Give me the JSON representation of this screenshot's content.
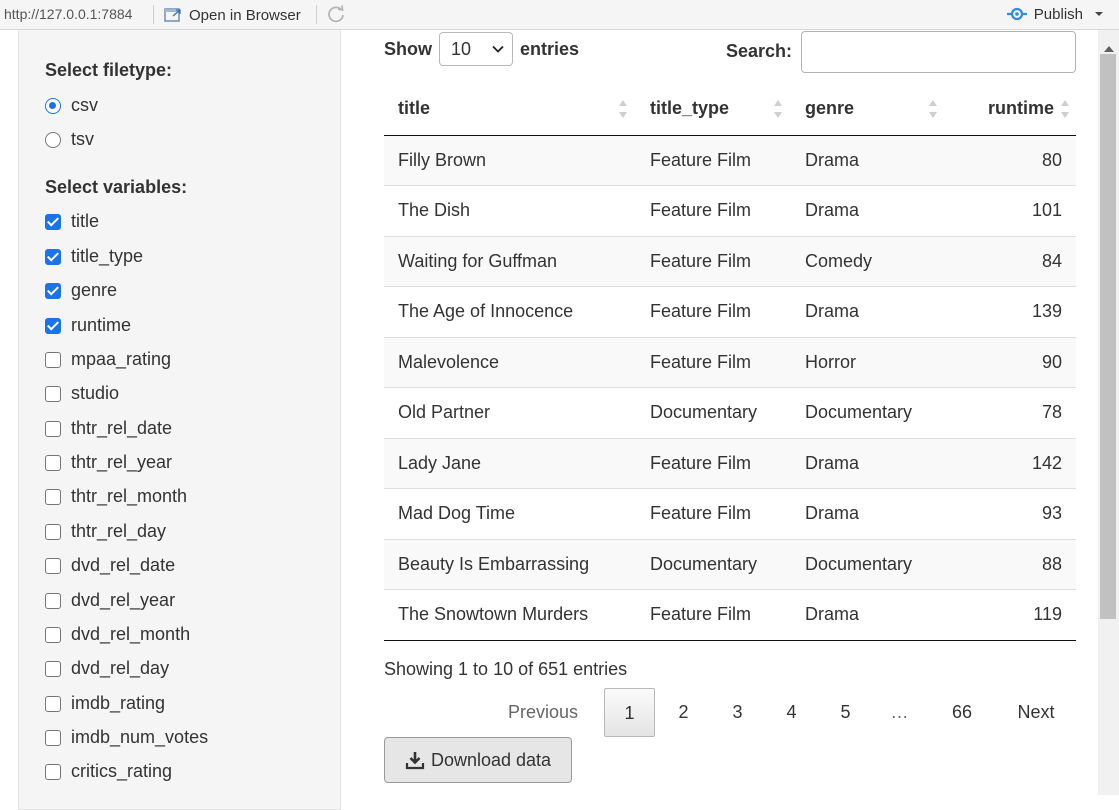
{
  "topbar": {
    "url": "http://127.0.0.1:7884",
    "open_in_browser": "Open in Browser",
    "publish": "Publish",
    "icons": [
      "open-browser-icon",
      "refresh-icon",
      "publish-icon",
      "caret-down-icon"
    ]
  },
  "sidebar": {
    "filetype_label": "Select filetype:",
    "filetypes": [
      {
        "label": "csv",
        "selected": true
      },
      {
        "label": "tsv",
        "selected": false
      }
    ],
    "variables_label": "Select variables:",
    "variables": [
      {
        "label": "title",
        "checked": true
      },
      {
        "label": "title_type",
        "checked": true
      },
      {
        "label": "genre",
        "checked": true
      },
      {
        "label": "runtime",
        "checked": true
      },
      {
        "label": "mpaa_rating",
        "checked": false
      },
      {
        "label": "studio",
        "checked": false
      },
      {
        "label": "thtr_rel_date",
        "checked": false
      },
      {
        "label": "thtr_rel_year",
        "checked": false
      },
      {
        "label": "thtr_rel_month",
        "checked": false
      },
      {
        "label": "thtr_rel_day",
        "checked": false
      },
      {
        "label": "dvd_rel_date",
        "checked": false
      },
      {
        "label": "dvd_rel_year",
        "checked": false
      },
      {
        "label": "dvd_rel_month",
        "checked": false
      },
      {
        "label": "dvd_rel_day",
        "checked": false
      },
      {
        "label": "imdb_rating",
        "checked": false
      },
      {
        "label": "imdb_num_votes",
        "checked": false
      },
      {
        "label": "critics_rating",
        "checked": false
      }
    ]
  },
  "table_controls": {
    "show_label": "Show",
    "entries_value": "10",
    "entries_label": "entries",
    "search_label": "Search:",
    "search_value": ""
  },
  "table": {
    "columns": [
      "title",
      "title_type",
      "genre",
      "runtime"
    ],
    "rows": [
      [
        "Filly Brown",
        "Feature Film",
        "Drama",
        "80"
      ],
      [
        "The Dish",
        "Feature Film",
        "Drama",
        "101"
      ],
      [
        "Waiting for Guffman",
        "Feature Film",
        "Comedy",
        "84"
      ],
      [
        "The Age of Innocence",
        "Feature Film",
        "Drama",
        "139"
      ],
      [
        "Malevolence",
        "Feature Film",
        "Horror",
        "90"
      ],
      [
        "Old Partner",
        "Documentary",
        "Documentary",
        "78"
      ],
      [
        "Lady Jane",
        "Feature Film",
        "Drama",
        "142"
      ],
      [
        "Mad Dog Time",
        "Feature Film",
        "Drama",
        "93"
      ],
      [
        "Beauty Is Embarrassing",
        "Documentary",
        "Documentary",
        "88"
      ],
      [
        "The Snowtown Murders",
        "Feature Film",
        "Drama",
        "119"
      ]
    ]
  },
  "info": "Showing 1 to 10 of 651 entries",
  "pagination": {
    "previous": "Previous",
    "pages": [
      "1",
      "2",
      "3",
      "4",
      "5",
      "…",
      "66"
    ],
    "current": "1",
    "next": "Next"
  },
  "download": {
    "label": "Download data",
    "icon": "download-icon"
  },
  "colors": {
    "accent": "#1a73e8",
    "sidebar_bg": "#f5f5f5",
    "stripe": "#f9f9f9"
  }
}
